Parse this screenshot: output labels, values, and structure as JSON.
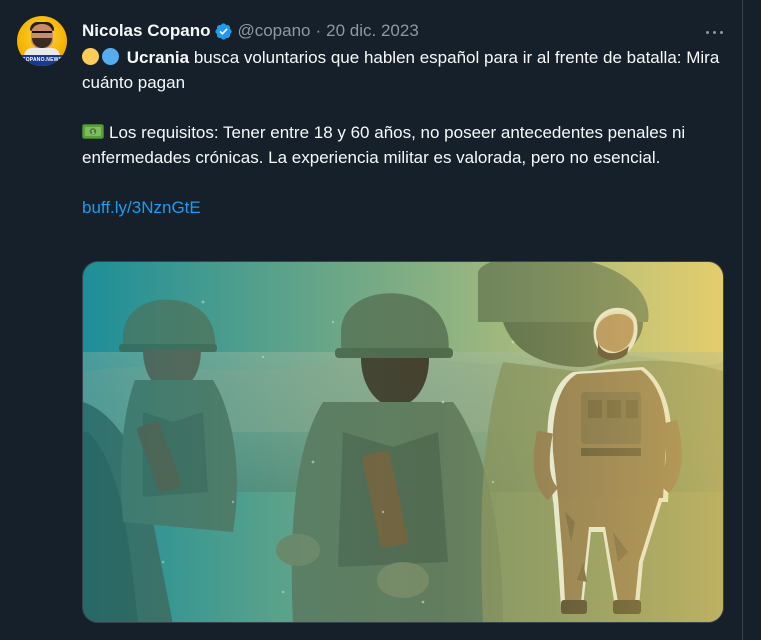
{
  "tweet": {
    "author_name": "Nicolas Copano",
    "handle": "@copano",
    "separator": "·",
    "date": "20 dic. 2023",
    "avatar_label": "COPANO.NEWS",
    "text": {
      "line1_bold": "Ucrania",
      "line1_rest": " busca voluntarios que hablen español para ir al frente de batalla: Mira cuánto pagan",
      "requirements": "Los requisitos: Tener entre 18 y 60 años, no poseer antecedentes penales ni enfermedades crónicas. La experiencia militar es valorada, pero no esencial.",
      "link": "buff.ly/3NznGtE"
    },
    "icons": {
      "verified": "verified-badge-icon",
      "more": "more-options-icon",
      "money": "dollar-banknote-icon",
      "flag_circles": [
        "yellow-circle-icon",
        "blue-circle-icon"
      ]
    },
    "colors": {
      "background": "#15202b",
      "text": "#f7f9f9",
      "secondary": "#8b98a5",
      "link": "#1d9bf0",
      "verified": "#1d9bf0"
    }
  }
}
